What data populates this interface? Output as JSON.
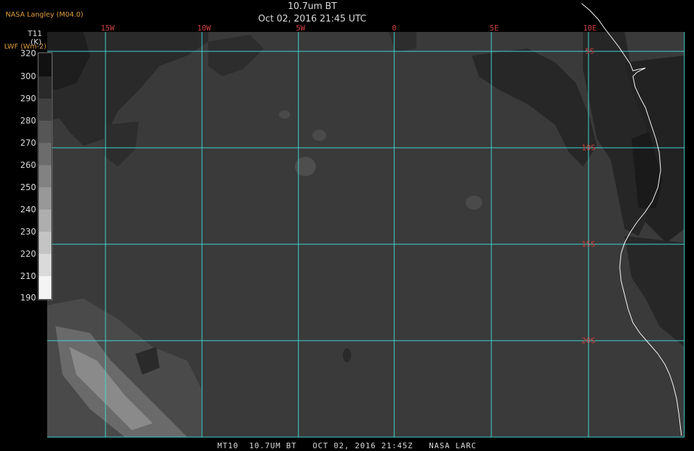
{
  "header": {
    "provider": "NASA Langley (M04.0)",
    "title": "10.7um BT",
    "subtitle": "Oct 02, 2016 21:45 UTC"
  },
  "legend": {
    "title_line1": "T11",
    "title_line2": "(K)",
    "title_line3": "LWF (Wm-2)",
    "ticks": [
      "320",
      "300",
      "290",
      "280",
      "270",
      "260",
      "250",
      "240",
      "230",
      "220",
      "210",
      "190"
    ]
  },
  "grid": {
    "lon_labels": [
      "15W",
      "10W",
      "5W",
      "0",
      "5E",
      "10E"
    ],
    "lat_labels": [
      "5S",
      "10S",
      "15S",
      "20S"
    ]
  },
  "footer": {
    "text": "MT10  10.7UM BT   OCT 02, 2016 21:45Z   NASA LARC"
  },
  "colors": {
    "grid": "#40d8d8",
    "labels": "#d04040",
    "coastline": "#ffffff",
    "background": "#000000",
    "ocean": "#3a3a3a"
  }
}
